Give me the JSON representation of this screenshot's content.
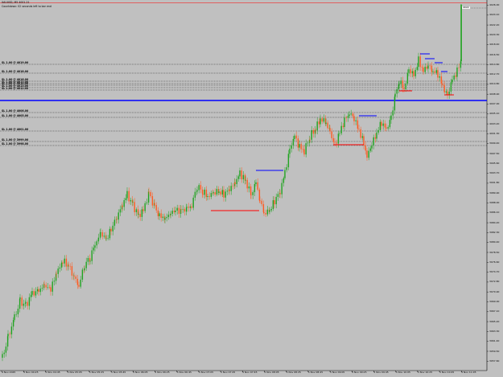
{
  "header": {
    "symbol_line": "XAUUSD, M5 4001.21",
    "info_line": "Countdown: 02 seconds left to bar end"
  },
  "colors": {
    "background": "#c0c0c0",
    "bull_candle": "#1fa31f",
    "bear_candle": "#ff5a1f",
    "blue_level": "#0000ff",
    "red_level": "#ff0000",
    "dotted_level": "#000000",
    "top_line": "#ff0000"
  },
  "current_price_label": "4022",
  "blue_horizontal_label": "",
  "level_labels": [
    "SL 1.00 @ 4019.00",
    "SL 1.00 @ 4018.00",
    "SL 1.00 @ 4016.00",
    "SL 1.00 @ 4015.00",
    "SL 1.00 @ 4014.00",
    "SL 1.00 @ 4013.00",
    "SL 1.00 @ 4012.00",
    "SL 1.00 @ 4006.00",
    "SL 1.00 @ 4005.00",
    "SL 1.00 @ 4001.00",
    "SL 1.00 @ 3999.00",
    "SL 1.00 @ 3998.00"
  ],
  "price_axis": [
    "4026.00",
    "4024.10",
    "4022.20",
    "4020.30",
    "4018.40",
    "4016.50",
    "4014.60",
    "4012.70",
    "4010.80",
    "4008.90",
    "4007.00",
    "4005.10",
    "4003.20",
    "4001.30",
    "3999.40",
    "3997.50",
    "3995.60",
    "3993.70",
    "3991.80",
    "3989.90",
    "3988.00",
    "3986.10",
    "3984.20",
    "3982.30",
    "3980.40",
    "3978.50",
    "3976.60",
    "3974.70",
    "3972.80",
    "3970.90",
    "3969.00",
    "3967.10",
    "3965.20",
    "3963.30",
    "3961.40",
    "3959.50",
    "3957.60"
  ],
  "time_axis": [
    "4 Nov 2025",
    "5 Nov 04:25",
    "5 Nov 04:45",
    "5 Nov 05:05",
    "5 Nov 05:25",
    "5 Nov 05:45",
    "5 Nov 06:05",
    "5 Nov 06:25",
    "5 Nov 06:45",
    "5 Nov 07:05",
    "5 Nov 07:25",
    "5 Nov 07:45",
    "5 Nov 08:05",
    "5 Nov 08:25",
    "5 Nov 08:45",
    "5 Nov 09:05",
    "5 Nov 09:25",
    "5 Nov 09:45",
    "5 Nov 10:05",
    "5 Nov 10:25",
    "5 Nov 10:45",
    "5 Nov 11:05"
  ]
}
